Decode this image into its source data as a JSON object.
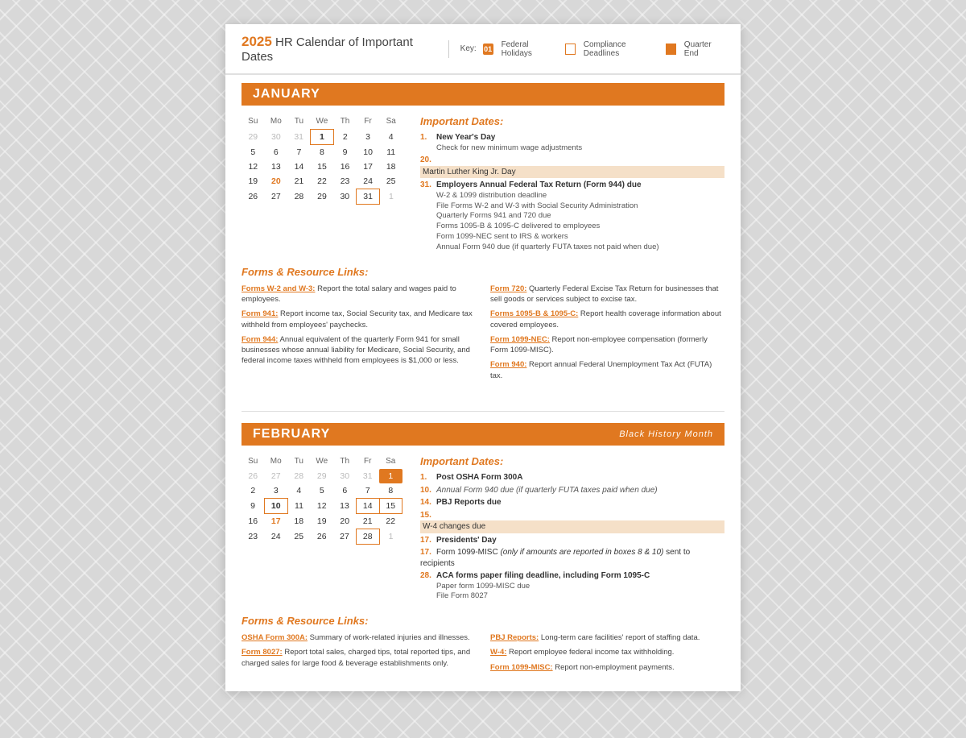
{
  "header": {
    "year": "2025",
    "title": "HR Calendar of Important Dates",
    "key_label": "Key:",
    "key_federal": "01",
    "key_federal_label": "Federal Holidays",
    "key_compliance_label": "Compliance Deadlines",
    "key_quarter_label": "Quarter End"
  },
  "january": {
    "month": "JANUARY",
    "important_title": "Important Dates:",
    "forms_title": "Forms & Resource Links:",
    "days_header": [
      "Su",
      "Mo",
      "Tu",
      "We",
      "Th",
      "Fr",
      "Sa"
    ],
    "weeks": [
      [
        {
          "d": "29",
          "m": true
        },
        {
          "d": "30",
          "m": true
        },
        {
          "d": "31",
          "m": true
        },
        {
          "d": "1",
          "holiday": true,
          "boxed": true
        },
        {
          "d": "2"
        },
        {
          "d": "3"
        },
        {
          "d": "4"
        }
      ],
      [
        {
          "d": "5"
        },
        {
          "d": "6"
        },
        {
          "d": "7"
        },
        {
          "d": "8"
        },
        {
          "d": "9"
        },
        {
          "d": "10"
        },
        {
          "d": "11"
        }
      ],
      [
        {
          "d": "12"
        },
        {
          "d": "13"
        },
        {
          "d": "14"
        },
        {
          "d": "15"
        },
        {
          "d": "16"
        },
        {
          "d": "17"
        },
        {
          "d": "18"
        }
      ],
      [
        {
          "d": "19"
        },
        {
          "d": "20",
          "holiday": true
        },
        {
          "d": "21"
        },
        {
          "d": "22"
        },
        {
          "d": "23"
        },
        {
          "d": "24"
        },
        {
          "d": "25"
        }
      ],
      [
        {
          "d": "26"
        },
        {
          "d": "27"
        },
        {
          "d": "28"
        },
        {
          "d": "29"
        },
        {
          "d": "30"
        },
        {
          "d": "31",
          "boxed": true
        },
        {
          "d": "1",
          "m": true
        }
      ]
    ],
    "important_dates": [
      {
        "day": "1.",
        "label": "New Year's Day",
        "subs": [
          "Check for new minimum wage adjustments"
        ]
      },
      {
        "day": "20.",
        "label": "Martin Luther King Jr. Day",
        "highlighted": true,
        "subs": []
      },
      {
        "day": "31.",
        "label": "Employers Annual Federal Tax Return (Form 944) due",
        "subs": [
          "W-2 & 1099 distribution deadline",
          "File Forms W-2 and W-3 with Social Security Administration",
          "Quarterly Forms 941 and 720 due",
          "Forms 1095-B & 1095-C delivered to employees",
          "Form 1099-NEC sent to IRS & workers",
          "Annual Form 940 due (if quarterly FUTA taxes not paid when due)"
        ]
      }
    ],
    "forms_left": [
      {
        "link": "Form 720:",
        "text": " Quarterly Federal Excise Tax Return for businesses that sell goods or services subject to excise tax."
      },
      {
        "link": "Forms 1095-B & 1095-C:",
        "text": " Report health coverage information about covered employees."
      },
      {
        "link": "Form 1099-NEC:",
        "text": " Report non-employee compensation (formerly Form 1099-MISC)."
      },
      {
        "link": "Form 940:",
        "text": " Report annual Federal Unemployment Tax Act (FUTA) tax."
      }
    ],
    "forms_right": [
      {
        "link": "Forms W-2 and W-3:",
        "text": " Report the total salary and wages paid to employees."
      },
      {
        "link": "Form 941:",
        "text": " Report income tax, Social Security tax, and Medicare tax withheld from employees' paychecks."
      },
      {
        "link": "Form 944:",
        "text": " Annual equivalent of the quarterly Form 941 for small businesses whose annual liability for Medicare, Social Security, and federal income taxes withheld from employees is $1,000 or less."
      }
    ]
  },
  "february": {
    "month": "FEBRUARY",
    "subtitle": "Black History Month",
    "important_title": "Important Dates:",
    "forms_title": "Forms & Resource Links:",
    "days_header": [
      "Su",
      "Mo",
      "Tu",
      "We",
      "Th",
      "Fr",
      "Sa"
    ],
    "weeks": [
      [
        {
          "d": "26",
          "m": true
        },
        {
          "d": "27",
          "m": true
        },
        {
          "d": "28",
          "m": true
        },
        {
          "d": "29",
          "m": true
        },
        {
          "d": "30",
          "m": true
        },
        {
          "d": "31",
          "m": true
        },
        {
          "d": "1",
          "quarter": true
        }
      ],
      [
        {
          "d": "2"
        },
        {
          "d": "3"
        },
        {
          "d": "4"
        },
        {
          "d": "5"
        },
        {
          "d": "6"
        },
        {
          "d": "7"
        },
        {
          "d": "8"
        }
      ],
      [
        {
          "d": "9"
        },
        {
          "d": "10",
          "holiday": true,
          "boxed": true
        },
        {
          "d": "11"
        },
        {
          "d": "12"
        },
        {
          "d": "13"
        },
        {
          "d": "14",
          "boxed": true
        },
        {
          "d": "15",
          "boxed": true
        }
      ],
      [
        {
          "d": "16"
        },
        {
          "d": "17",
          "holiday": true
        },
        {
          "d": "18"
        },
        {
          "d": "19"
        },
        {
          "d": "20"
        },
        {
          "d": "21"
        },
        {
          "d": "22"
        }
      ],
      [
        {
          "d": "23"
        },
        {
          "d": "24"
        },
        {
          "d": "25"
        },
        {
          "d": "26"
        },
        {
          "d": "27"
        },
        {
          "d": "28",
          "boxed": true
        },
        {
          "d": "1",
          "m": true
        }
      ]
    ],
    "important_dates": [
      {
        "day": "1.",
        "label": "Post OSHA Form 300A",
        "subs": []
      },
      {
        "day": "10.",
        "label": "Annual Form 940 due (if quarterly FUTA taxes paid when due)",
        "italic": true,
        "subs": []
      },
      {
        "day": "14.",
        "label": "PBJ Reports due",
        "subs": []
      },
      {
        "day": "15.",
        "label": "W-4 changes due",
        "highlighted": true,
        "subs": []
      },
      {
        "day": "17.",
        "label": "Presidents' Day",
        "subs": []
      },
      {
        "day": "17.",
        "label": "Form 1099-MISC (only if amounts are reported in boxes 8 & 10) sent to recipients",
        "italic_part": true,
        "subs": []
      },
      {
        "day": "28.",
        "label": "ACA forms paper filing deadline, including Form 1095-C",
        "subs": [
          "Paper form 1099-MISC due",
          "File Form 8027"
        ]
      }
    ],
    "forms_left": [
      {
        "link": "PBJ Reports:",
        "text": " Long-term care facilities' report of staffing data."
      },
      {
        "link": "W-4:",
        "text": " Report employee federal income tax withholding."
      },
      {
        "link": "Form 1099-MISC:",
        "text": " Report non-employment payments."
      }
    ],
    "forms_right": [
      {
        "link": "OSHA Form 300A:",
        "text": " Summary of work-related injuries and illnesses."
      },
      {
        "link": "Form 8027:",
        "text": " Report total sales, charged tips, total reported tips, and charged sales for large food & beverage establishments only."
      }
    ]
  }
}
